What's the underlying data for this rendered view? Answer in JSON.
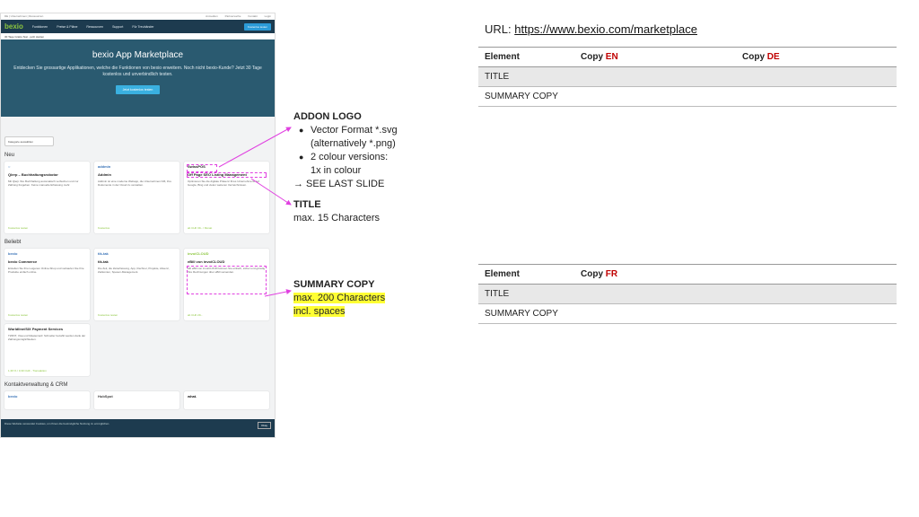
{
  "screenshot": {
    "topbar_items": [
      "DE | Unternehmen | Ressourcen",
      "Anmelden",
      "Partnersuche",
      "Kontakt",
      "Login"
    ],
    "logo": "bexio",
    "nav_items": [
      "Funktionen",
      "Preise & Pläne",
      "Ressourcen",
      "Support",
      "Für Treuhänder"
    ],
    "nav_button": "Kostenlos testen",
    "promo": "30 Tage Gratis-Test - jetzt starten",
    "hero_title": "bexio App Marketplace",
    "hero_text": "Entdecken Sie grossartige Applikationen, welche die Funktionen von bexio erweitern. Noch nicht bexio-Kunde? Jetzt 30 Tage kostenlos und unverbindlich testen.",
    "hero_button": "Jetzt kostenlos testen",
    "filter": "Kategorie auswählen",
    "sections": [
      "Neu",
      "Beliebt",
      "Kontaktverwaltung & CRM"
    ],
    "cards_new": [
      {
        "logo": "○",
        "title": "Qlerp – Buchhaltungsrobotor",
        "text": "Mit Qlerp Ihre Buchhaltung automatisch verbuchen und zur Zahlung freigeben. Keine manuelle Erfassung mehr.",
        "foot": "Kostenlos testen"
      },
      {
        "logo": "addmin",
        "title": "Addmin",
        "text": "Addmin ist eine moderne Webapp, die Unternehmen hilft, ihre Dokumente in der Cloud zu verwalten.",
        "foot": "Kostenlos"
      },
      {
        "logo": "SwissPOS",
        "title": "Off Page SEO Listing Management",
        "text": "Optimieren Sie die digitale Präsenz Ihres Unternehmens auf Google, Bing und vielen weiteren Verzeichnissen.",
        "foot": "ab CHF 39.- / Monat"
      }
    ],
    "cards_popular": [
      {
        "logo": "bexio",
        "title": "bexio Commerce",
        "text": "Erstellen Sie Ihren eigenen Online-Shop und verkaufen Sie Ihre Produkte einfach online.",
        "foot": "Kostenlos testen"
      },
      {
        "logo": "tik-tak",
        "title": "tik-tak",
        "text": "Die Zeit, die Zeiterfassung, App, Rechner, Projekte, Absenz, Zeitkonten, Spesen-Management.",
        "foot": "Kostenlos testen"
      },
      {
        "logo": "invoiCLOUD",
        "title": "eBill von invoiCLOUD",
        "text": "Mit eBill von invoiCLOUD können Sie einfach, sicher und günstig Ihre Rechnungen über eBill versenden.",
        "foot": "ab CHF 29.-"
      }
    ],
    "card_worldline": {
      "title": "Worldline/SIX Payment Services",
      "text": "TWINT, Visa und Mastercard: Schneller bezahlt werden dank der Zahlungsmöglichkeiten.",
      "foot": "1,39 % / 0,30 CHF - Transaktion"
    },
    "crm_logos": [
      "bexio",
      "HubSpot",
      "what."
    ],
    "cookie_text": "Diese Website verwendet Cookies, um Ihnen die bestmögliche Nutzung zu ermöglichen.",
    "cookie_button": "Okay"
  },
  "annotations": {
    "logo_title": "ADDON LOGO",
    "logo_bullets": [
      "Vector Format *.svg",
      "(alternatively *.png)",
      "2 colour versions:",
      "1x in colour"
    ],
    "see_last": "→ SEE LAST SLIDE",
    "title_label": "TITLE",
    "title_limit": "max. 15 Characters",
    "summary_label": "SUMMARY COPY",
    "summary_limit_1": "max. 200 Characters",
    "summary_limit_2": "incl. spaces"
  },
  "url": {
    "prefix": "URL: ",
    "link": "https://www.bexio.com/marketplace"
  },
  "table1": {
    "headers": [
      "Element",
      "Copy ",
      "EN",
      "Copy ",
      "DE"
    ],
    "rows": [
      "TITLE",
      "SUMMARY COPY"
    ]
  },
  "table2": {
    "headers": [
      "Element",
      "Copy ",
      "FR"
    ],
    "rows": [
      "TITLE",
      "SUMMARY COPY"
    ]
  },
  "colors": {
    "accent_red": "#c00000",
    "highlight": "#ffff33",
    "arrow": "#e040e0"
  }
}
